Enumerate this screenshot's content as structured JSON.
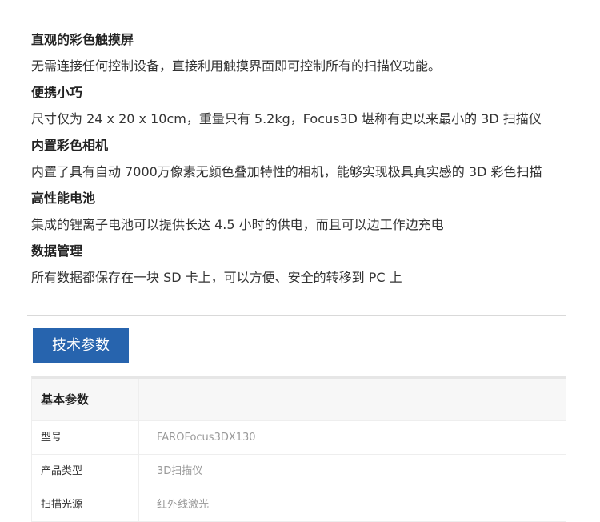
{
  "features": [
    {
      "title": "直观的彩色触摸屏",
      "desc": "无需连接任何控制设备，直接利用触摸界面即可控制所有的扫描仪功能。"
    },
    {
      "title": "便携小巧",
      "desc": "尺寸仅为 24 x 20 x 10cm，重量只有 5.2kg，Focus3D 堪称有史以来最小的 3D 扫描仪"
    },
    {
      "title": "内置彩色相机",
      "desc": "内置了具有自动 7000万像素无颜色叠加特性的相机，能够实现极具真实感的 3D 彩色扫描"
    },
    {
      "title": "高性能电池",
      "desc": "集成的锂离子电池可以提供长达 4.5 小时的供电，而且可以边工作边充电"
    },
    {
      "title": "数据管理",
      "desc": "所有数据都保存在一块 SD 卡上，可以方便、安全的转移到 PC 上"
    }
  ],
  "spec_tab": {
    "label": "技术参数"
  },
  "spec_table": {
    "header": "基本参数",
    "rows": [
      {
        "key": "型号",
        "value": "FAROFocus3DX130"
      },
      {
        "key": "产品类型",
        "value": "3D扫描仪"
      },
      {
        "key": "扫描光源",
        "value": "红外线激光"
      }
    ]
  },
  "colors": {
    "tab_background": "#2764ae",
    "text": "#333333",
    "muted_text": "#999999"
  }
}
